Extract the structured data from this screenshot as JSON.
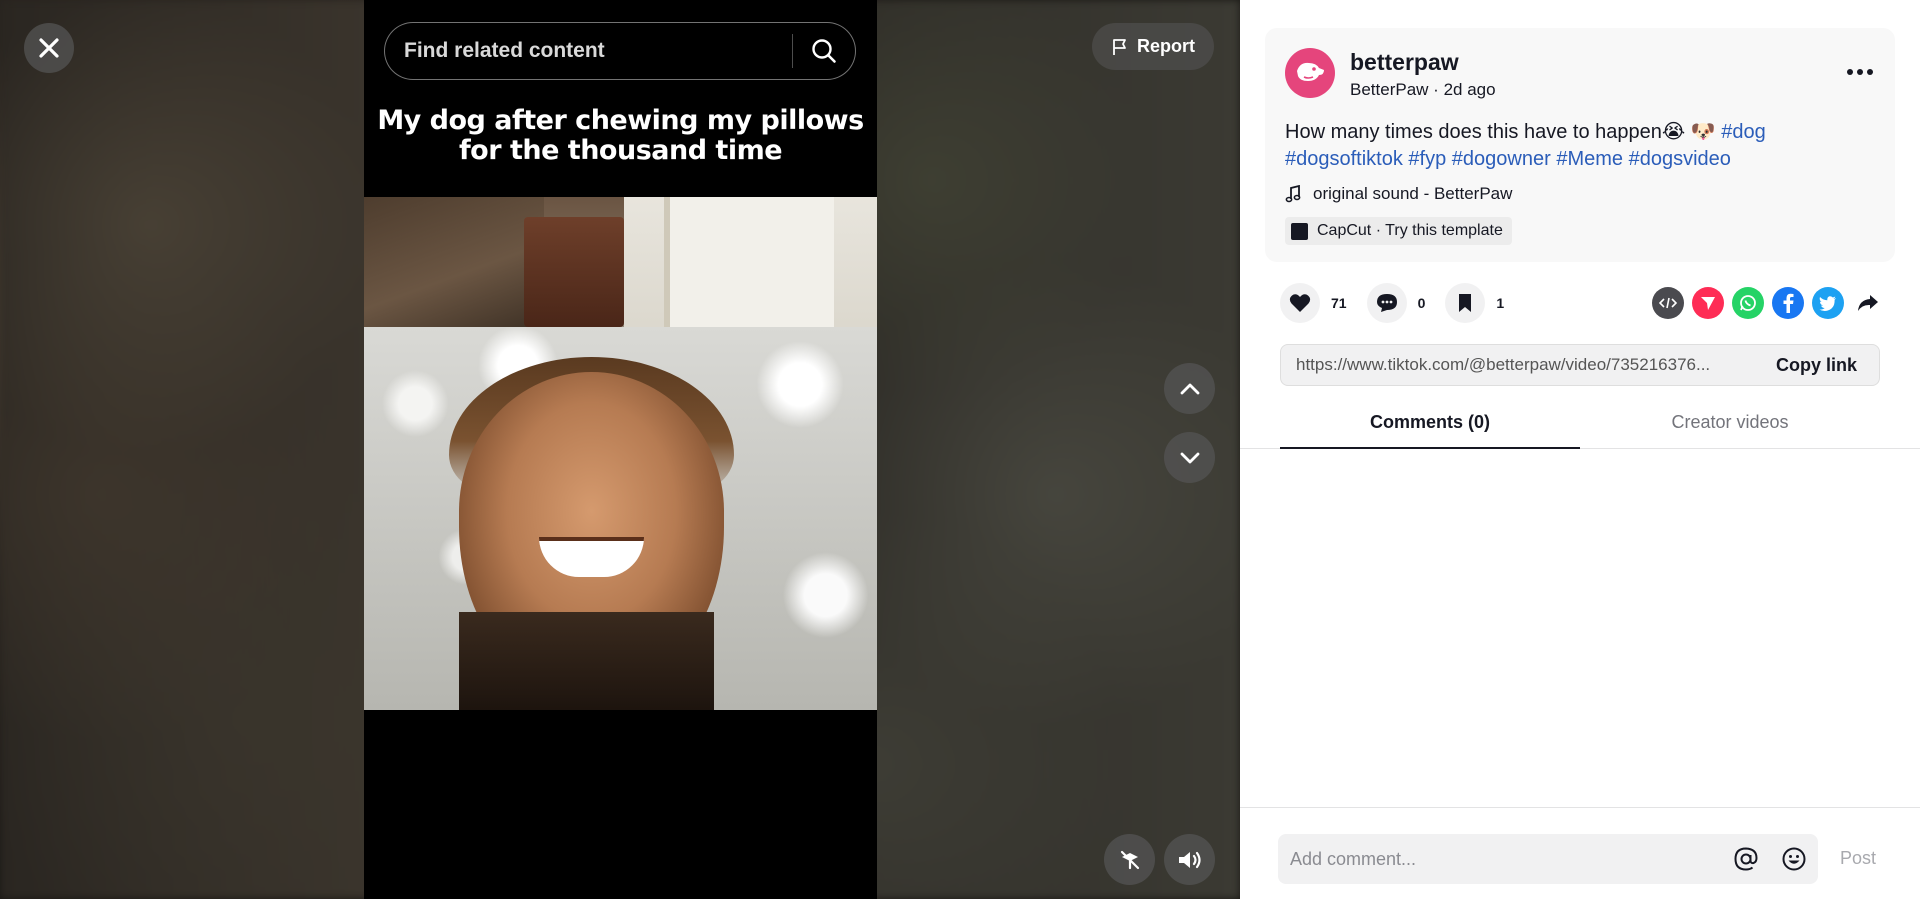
{
  "video": {
    "caption": "My dog after chewing my pillows for the thousand time",
    "search_placeholder": "Find related content",
    "report_label": "Report"
  },
  "post": {
    "username": "betterpaw",
    "display_name": "BetterPaw",
    "time_ago": "2d ago",
    "description_text": "How many times does this have to happen😭 🐶",
    "hashtags": [
      "#dog",
      "#dogsoftiktok",
      "#fyp",
      "#dogowner",
      "#Meme",
      "#dogsvideo"
    ],
    "music": "original sound - BetterPaw",
    "capcut": "CapCut · Try this template"
  },
  "actions": {
    "likes": "71",
    "comments": "0",
    "saves": "1"
  },
  "share": {
    "colors": {
      "embed": "#4a4a4f",
      "send": "#fe2c55",
      "whatsapp": "#25d366",
      "facebook": "#1877f2",
      "twitter": "#1da1f2"
    },
    "link": "https://www.tiktok.com/@betterpaw/video/735216376...",
    "copy_label": "Copy link"
  },
  "tabs": [
    {
      "label": "Comments (0)",
      "active": true
    },
    {
      "label": "Creator videos",
      "active": false
    }
  ],
  "comment": {
    "placeholder": "Add comment...",
    "post_label": "Post"
  },
  "theme": {
    "brand": "#fe2c55",
    "avatar": "#e5457c",
    "hashtag": "#2b5db9"
  }
}
